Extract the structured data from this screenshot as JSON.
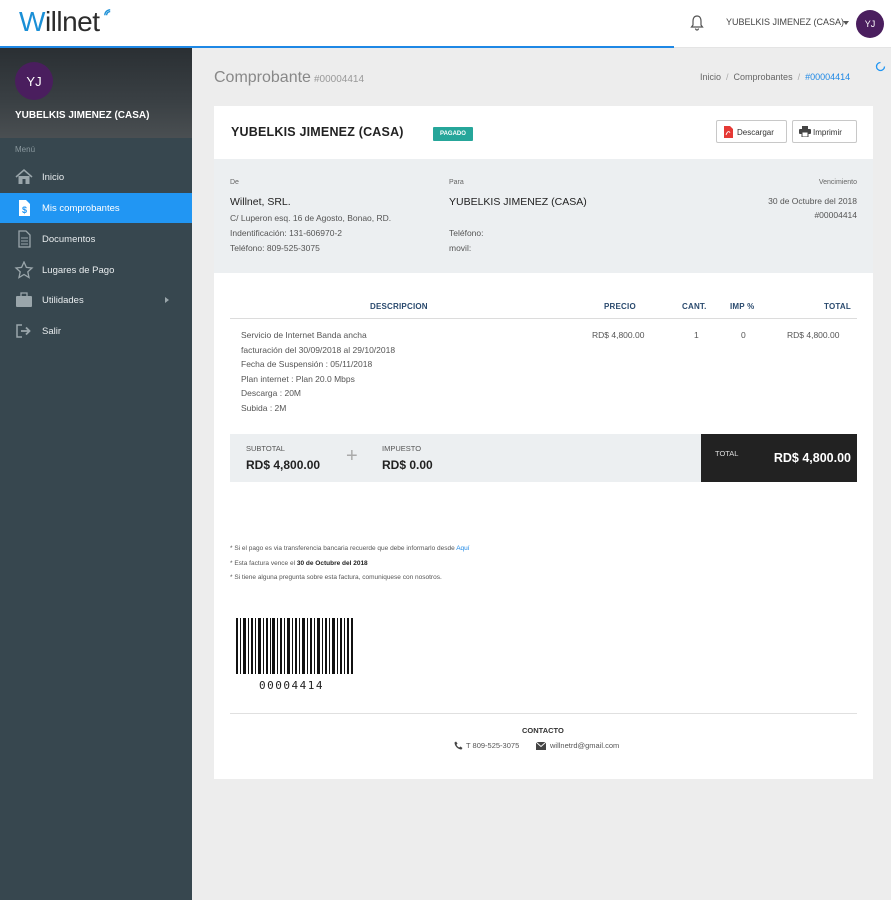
{
  "header": {
    "logo_w": "W",
    "logo_rest": "illnet",
    "user_name": "YUBELKIS JIMENEZ (CASA)",
    "avatar_initials": "YJ"
  },
  "sidebar": {
    "avatar_initials": "YJ",
    "profile_name": "YUBELKIS JIMENEZ (CASA)",
    "menu_label": "Menú",
    "items": [
      {
        "label": "Inicio",
        "icon": "home-icon"
      },
      {
        "label": "Mis comprobantes",
        "icon": "document-dollar-icon",
        "active": true
      },
      {
        "label": "Documentos",
        "icon": "file-icon"
      },
      {
        "label": "Lugares de Pago",
        "icon": "star-icon"
      },
      {
        "label": "Utilidades",
        "icon": "briefcase-icon"
      },
      {
        "label": "Salir",
        "icon": "sign-out-icon"
      }
    ]
  },
  "page": {
    "title": "Comprobante",
    "title_number": "#00004414",
    "breadcrumb": [
      "Inicio",
      "Comprobantes",
      "#00004414"
    ]
  },
  "invoice": {
    "customer_name": "YUBELKIS JIMENEZ (CASA)",
    "status_badge": "PAGADO",
    "download_label": "Descargar",
    "print_label": "Imprimir",
    "from": {
      "label": "De",
      "company": "Willnet, SRL.",
      "address": "C/ Luperon esq. 16 de Agosto, Bonao, RD.",
      "identification": "Indentificación: 131-606970-2",
      "phone": "Teléfono: 809-525-3075"
    },
    "to": {
      "label": "Para",
      "name": "YUBELKIS JIMENEZ (CASA)",
      "phone_label": "Teléfono:",
      "mobile_label": "movil:"
    },
    "due": {
      "label": "Vencimiento",
      "date": "30 de Octubre del 2018",
      "number": "#00004414"
    },
    "columns": {
      "description": "DESCRIPCION",
      "price": "PRECIO",
      "qty": "CANT.",
      "tax": "IMP %",
      "total": "TOTAL"
    },
    "item": {
      "description": "Servicio de Internet Banda ancha\nfacturación del 30/09/2018 al 29/10/2018\nFecha de Suspensión : 05/11/2018\nPlan internet : Plan 20.0 Mbps\nDescarga : 20M\nSubida : 2M",
      "price": "RD$ 4,800.00",
      "qty": "1",
      "tax": "0",
      "total": "RD$ 4,800.00"
    },
    "subtotal_label": "SUBTOTAL",
    "subtotal": "RD$ 4,800.00",
    "tax_label": "IMPUESTO",
    "tax_total": "RD$ 0.00",
    "total_label": "TOTAL",
    "grand_total": "RD$ 4,800.00",
    "notes": {
      "n1_text": "* Si el pago es via transferencia bancaria recuerde que debe informarlo desde",
      "n1_link": "Aquí",
      "n2_text": "* Esta factura vence el",
      "n2_date": "30 de Octubre del 2018",
      "n3_text": "* Si tiene alguna pregunta sobre esta factura, comuniquese con nosotros."
    },
    "barcode_number": "00004414",
    "contact_title": "CONTACTO",
    "contact_phone": "T 809-525-3075",
    "contact_email": "willnetrd@gmail.com"
  },
  "colors": {
    "accent": "#2196f3",
    "sidebar": "#37474f",
    "badge": "#26a69a",
    "avatar": "#4a1e5e"
  }
}
